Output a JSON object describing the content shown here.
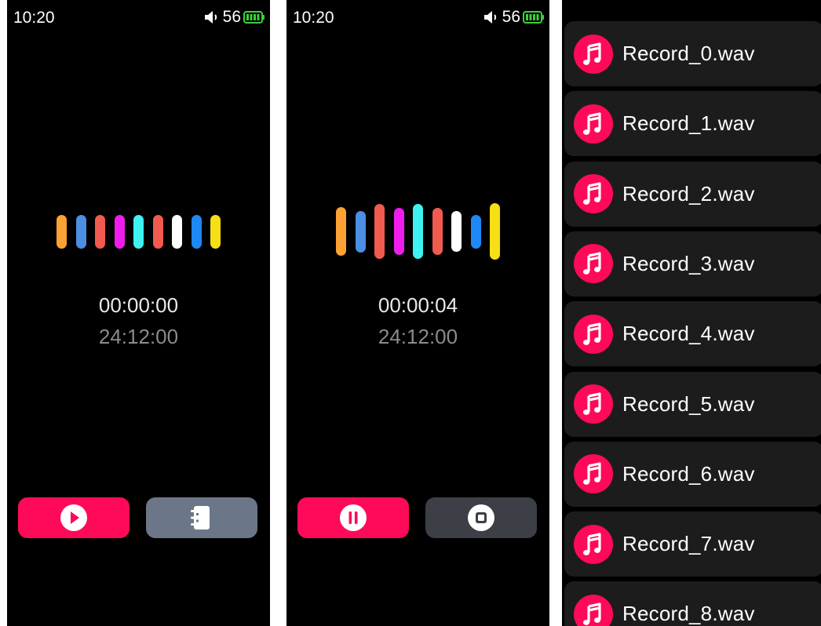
{
  "screens": [
    {
      "id": "recorder-idle",
      "clock": "10:20",
      "volume": "56",
      "elapsed": "00:00:00",
      "remaining": "24:12:00",
      "waveform": {
        "colors": [
          "#fca233",
          "#4b8ee3",
          "#f15a4f",
          "#ee1dee",
          "#3ef2f2",
          "#f15a4f",
          "#ffffff",
          "#1e88f4",
          "#f6df14"
        ],
        "levels": [
          0.43,
          0.43,
          0.43,
          0.43,
          0.43,
          0.43,
          0.43,
          0.43,
          0.43
        ]
      },
      "left_button": {
        "icon": "play-icon",
        "color": "#ff0a58"
      },
      "right_button": {
        "icon": "list-icon",
        "color": "#6b7788"
      }
    },
    {
      "id": "recorder-recording",
      "clock": "10:20",
      "volume": "56",
      "elapsed": "00:00:04",
      "remaining": "24:12:00",
      "waveform": {
        "colors": [
          "#fca233",
          "#4b8ee3",
          "#f15a4f",
          "#ee1dee",
          "#3ef2f2",
          "#f15a4f",
          "#ffffff",
          "#1e88f4",
          "#f6df14"
        ],
        "levels": [
          0.62,
          0.53,
          0.7,
          0.6,
          0.7,
          0.6,
          0.52,
          0.43,
          0.72
        ]
      },
      "left_button": {
        "icon": "pause-icon",
        "color": "#ff0a58"
      },
      "right_button": {
        "icon": "stop-icon",
        "color": "#3c3f46"
      }
    }
  ],
  "recordings": [
    "Record_0.wav",
    "Record_1.wav",
    "Record_2.wav",
    "Record_3.wav",
    "Record_4.wav",
    "Record_5.wav",
    "Record_6.wav",
    "Record_7.wav",
    "Record_8.wav"
  ],
  "accent_color": "#ff0a58"
}
